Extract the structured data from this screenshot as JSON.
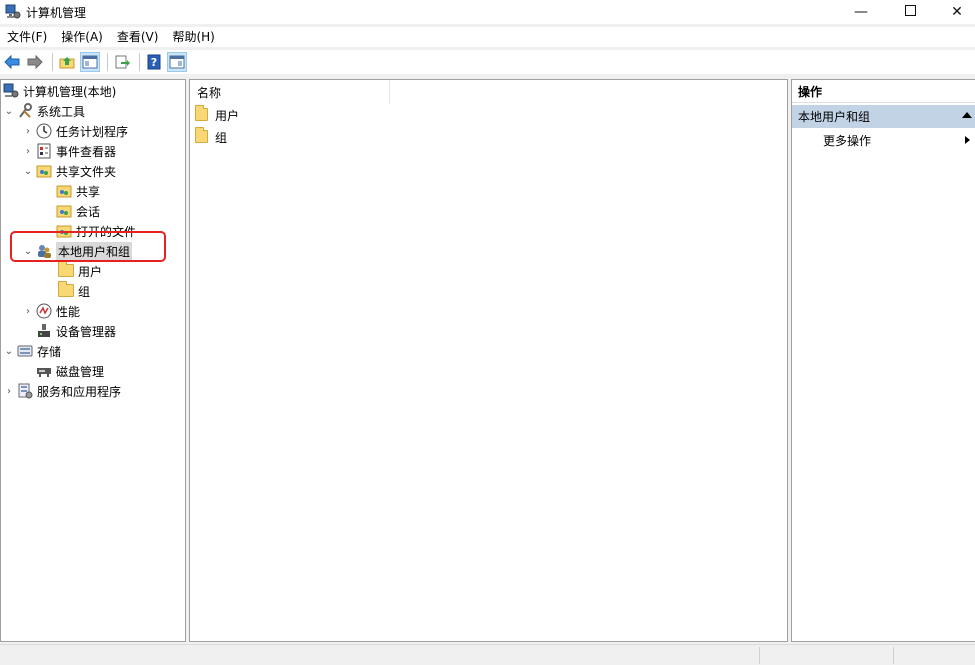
{
  "window": {
    "title": "计算机管理",
    "min_glyph": "—",
    "max_glyph": "☐",
    "close_glyph": "✕"
  },
  "menu": [
    "文件(F)",
    "操作(A)",
    "查看(V)",
    "帮助(H)"
  ],
  "tree": {
    "root": "计算机管理(本地)",
    "system_tools": "系统工具",
    "task_scheduler": "任务计划程序",
    "event_viewer": "事件查看器",
    "shared_folders": "共享文件夹",
    "shares": "共享",
    "sessions": "会话",
    "open_files": "打开的文件",
    "local_users_groups": "本地用户和组",
    "users": "用户",
    "groups": "组",
    "performance": "性能",
    "device_manager": "设备管理器",
    "storage": "存储",
    "disk_management": "磁盘管理",
    "services_apps": "服务和应用程序"
  },
  "center": {
    "column_name": "名称",
    "items": [
      "用户",
      "组"
    ]
  },
  "actions": {
    "header": "操作",
    "section": "本地用户和组",
    "more": "更多操作"
  },
  "colors": {
    "selection_box": "#e52222",
    "action_section_bg": "#c3d3e6",
    "folder": "#f8d775"
  }
}
